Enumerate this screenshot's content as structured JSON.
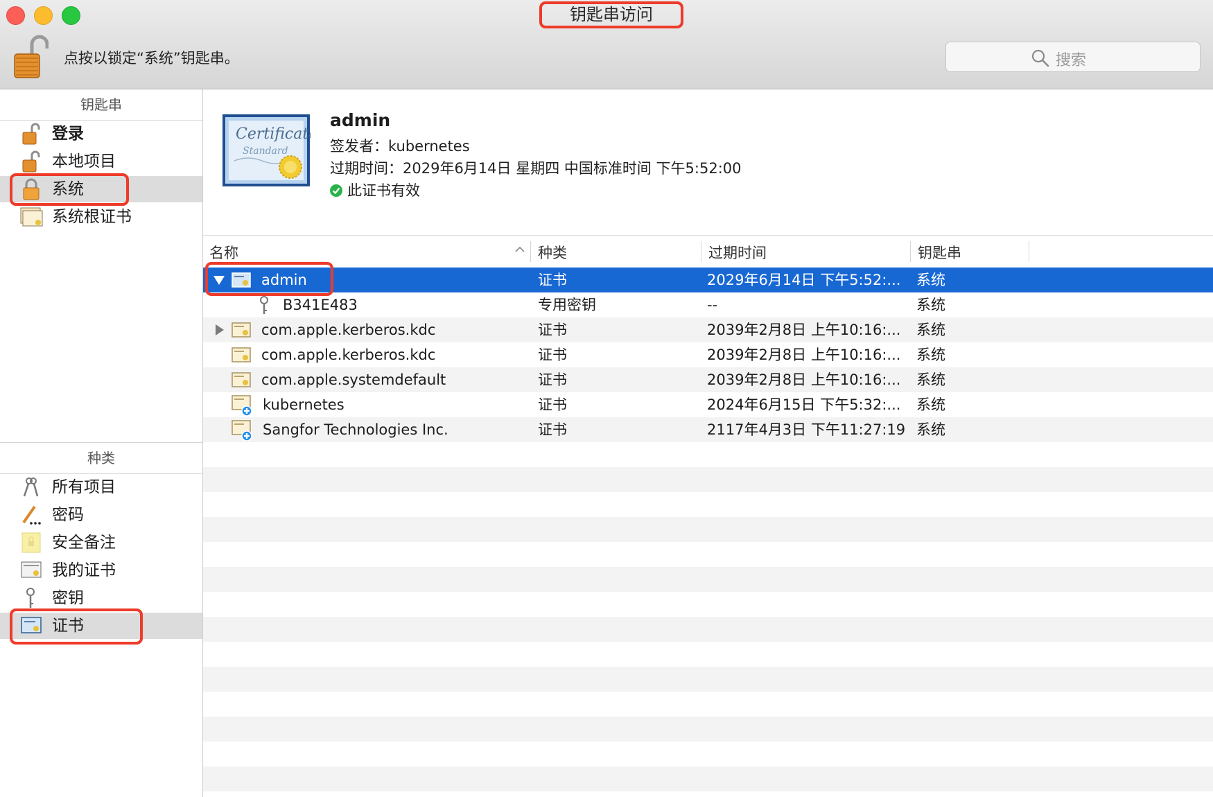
{
  "window": {
    "title": "钥匙串访问"
  },
  "toolbar": {
    "lock_hint": "点按以锁定“系统”钥匙串。",
    "search_placeholder": "搜索"
  },
  "sidebar": {
    "keychains_header": "钥匙串",
    "keychains": [
      {
        "label": "登录",
        "icon": "lock-open-icon"
      },
      {
        "label": "本地项目",
        "icon": "lock-open-icon"
      },
      {
        "label": "系统",
        "icon": "lock-icon"
      },
      {
        "label": "系统根证书",
        "icon": "certificate-stack-icon"
      }
    ],
    "categories_header": "种类",
    "categories": [
      {
        "label": "所有项目",
        "icon": "keys-icon"
      },
      {
        "label": "密码",
        "icon": "pencil-icon"
      },
      {
        "label": "安全备注",
        "icon": "note-icon"
      },
      {
        "label": "我的证书",
        "icon": "my-certificate-icon"
      },
      {
        "label": "密钥",
        "icon": "key-icon"
      },
      {
        "label": "证书",
        "icon": "certificate-icon"
      }
    ]
  },
  "detail": {
    "name": "admin",
    "issuer": "签发者：kubernetes",
    "expires": "过期时间：2029年6月14日 星期四 中国标准时间 下午5:52:00",
    "status": "此证书有效"
  },
  "table": {
    "columns": [
      "名称",
      "种类",
      "过期时间",
      "钥匙串"
    ],
    "rows": [
      {
        "name": "admin",
        "kind": "证书",
        "expires": "2029年6月14日 下午5:52:...",
        "keychain": "系统"
      },
      {
        "name": "B341E483",
        "kind": "专用密钥",
        "expires": "--",
        "keychain": "系统"
      },
      {
        "name": "com.apple.kerberos.kdc",
        "kind": "证书",
        "expires": "2039年2月8日 上午10:16:...",
        "keychain": "系统"
      },
      {
        "name": "com.apple.kerberos.kdc",
        "kind": "证书",
        "expires": "2039年2月8日 上午10:16:...",
        "keychain": "系统"
      },
      {
        "name": "com.apple.systemdefault",
        "kind": "证书",
        "expires": "2039年2月8日 上午10:16:...",
        "keychain": "系统"
      },
      {
        "name": "kubernetes",
        "kind": "证书",
        "expires": "2024年6月15日 下午5:32:...",
        "keychain": "系统"
      },
      {
        "name": "Sangfor Technologies Inc.",
        "kind": "证书",
        "expires": "2117年4月3日 下午11:27:19",
        "keychain": "系统"
      }
    ]
  },
  "colors": {
    "selection": "#1868d4",
    "highlight_box": "#ee3b2a",
    "valid_green": "#2bb14a"
  }
}
